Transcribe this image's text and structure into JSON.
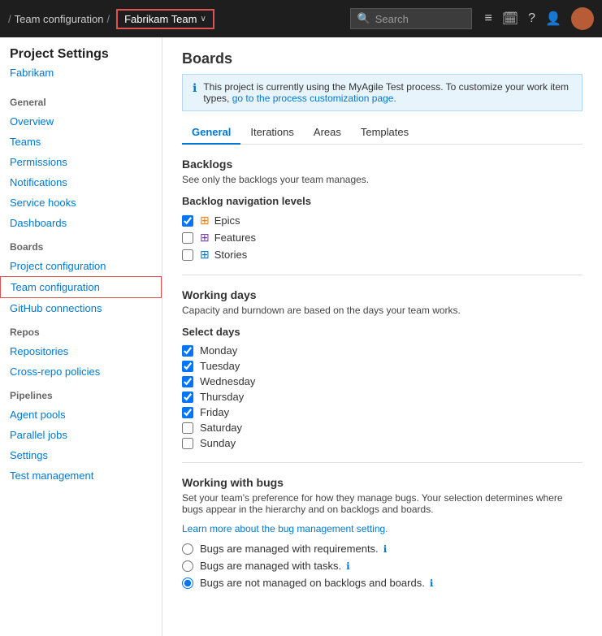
{
  "topbar": {
    "breadcrumb_sep1": "/",
    "breadcrumb_team_config": "Team configuration",
    "breadcrumb_sep2": "/",
    "team_name": "Fabrikam Team",
    "chevron": "∨",
    "search_placeholder": "Search",
    "icons": {
      "list": "≡",
      "calendar": "🗓",
      "help": "?",
      "user": "👤"
    },
    "avatar_initials": ""
  },
  "sidebar": {
    "title": "Project Settings",
    "project_name": "Fabrikam",
    "sections": [
      {
        "name": "General",
        "items": [
          {
            "label": "Overview",
            "id": "overview"
          },
          {
            "label": "Teams",
            "id": "teams"
          },
          {
            "label": "Permissions",
            "id": "permissions"
          },
          {
            "label": "Notifications",
            "id": "notifications"
          },
          {
            "label": "Service hooks",
            "id": "service-hooks"
          },
          {
            "label": "Dashboards",
            "id": "dashboards"
          }
        ]
      },
      {
        "name": "Boards",
        "items": [
          {
            "label": "Project configuration",
            "id": "project-configuration"
          },
          {
            "label": "Team configuration",
            "id": "team-configuration",
            "active": true
          },
          {
            "label": "GitHub connections",
            "id": "github-connections"
          }
        ]
      },
      {
        "name": "Repos",
        "items": [
          {
            "label": "Repositories",
            "id": "repositories"
          },
          {
            "label": "Cross-repo policies",
            "id": "cross-repo-policies"
          }
        ]
      },
      {
        "name": "Pipelines",
        "items": [
          {
            "label": "Agent pools",
            "id": "agent-pools"
          },
          {
            "label": "Parallel jobs",
            "id": "parallel-jobs"
          },
          {
            "label": "Settings",
            "id": "settings"
          },
          {
            "label": "Test management",
            "id": "test-management"
          }
        ]
      }
    ]
  },
  "main": {
    "title": "Boards",
    "info_banner": "This project is currently using the MyAgile Test process. To customize your work item types,",
    "info_link_text": "go to the process customization page.",
    "tabs": [
      {
        "label": "General",
        "active": true
      },
      {
        "label": "Iterations"
      },
      {
        "label": "Areas"
      },
      {
        "label": "Templates"
      }
    ],
    "backlogs": {
      "title": "Backlogs",
      "description": "See only the backlogs your team manages.",
      "nav_levels_title": "Backlog navigation levels",
      "items": [
        {
          "label": "Epics",
          "checked": true,
          "icon_type": "epics"
        },
        {
          "label": "Features",
          "checked": false,
          "icon_type": "features"
        },
        {
          "label": "Stories",
          "checked": false,
          "icon_type": "stories"
        }
      ]
    },
    "working_days": {
      "title": "Working days",
      "description": "Capacity and burndown are based on the days your team works.",
      "select_days_title": "Select days",
      "days": [
        {
          "label": "Monday",
          "checked": true
        },
        {
          "label": "Tuesday",
          "checked": true
        },
        {
          "label": "Wednesday",
          "checked": true
        },
        {
          "label": "Thursday",
          "checked": true
        },
        {
          "label": "Friday",
          "checked": true
        },
        {
          "label": "Saturday",
          "checked": false
        },
        {
          "label": "Sunday",
          "checked": false
        }
      ]
    },
    "working_with_bugs": {
      "title": "Working with bugs",
      "description": "Set your team's preference for how they manage bugs. Your selection determines where bugs appear in the hierarchy and on backlogs and boards.",
      "learn_more_text": "Learn more about the bug management setting.",
      "options": [
        {
          "label": "Bugs are managed with requirements.",
          "checked": false,
          "info": true
        },
        {
          "label": "Bugs are managed with tasks.",
          "checked": false,
          "info": true
        },
        {
          "label": "Bugs are not managed on backlogs and boards.",
          "checked": true,
          "info": true
        }
      ]
    }
  }
}
